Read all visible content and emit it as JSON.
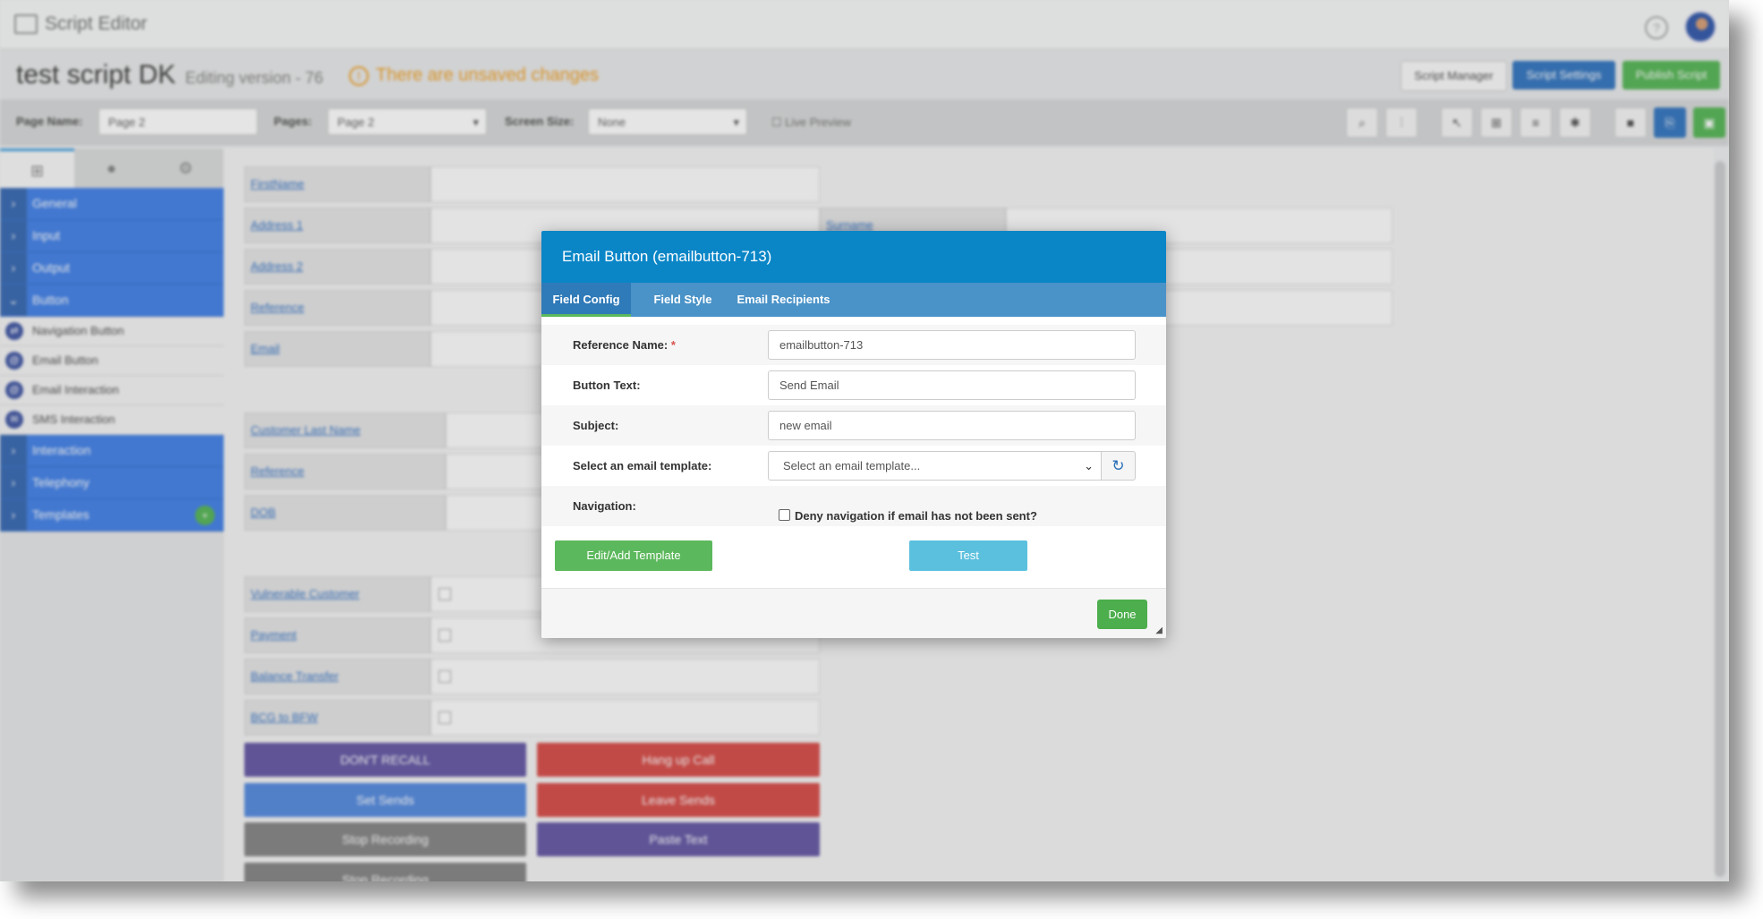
{
  "app": {
    "title": "Script Editor"
  },
  "header": {
    "script_name": "test script DK",
    "version": "Editing version - 76",
    "unsaved": "There are unsaved changes",
    "buttons": {
      "manager": "Script Manager",
      "settings": "Script Settings",
      "publish": "Publish Script"
    }
  },
  "pagebar": {
    "page_name_label": "Page Name:",
    "page_name_value": "Page 2",
    "pages_label": "Pages:",
    "pages_value": "Page 2",
    "screen_size_label": "Screen Size:",
    "screen_size_value": "None",
    "live_preview": "Live Preview",
    "tools": [
      "search-icon",
      "chart-icon",
      "pointer-icon",
      "sitemap-icon",
      "list-icon",
      "gear-icon",
      "save-icon",
      "copy-icon",
      "publish-icon"
    ]
  },
  "sidebar": {
    "categories_top": [
      {
        "label": "General"
      },
      {
        "label": "Input"
      },
      {
        "label": "Output"
      },
      {
        "label": "Button"
      }
    ],
    "button_items": [
      {
        "label": "Navigation Button"
      },
      {
        "label": "Email Button"
      },
      {
        "label": "Email Interaction"
      },
      {
        "label": "SMS Interaction"
      }
    ],
    "categories_bottom": [
      {
        "label": "Interaction"
      },
      {
        "label": "Telephony"
      },
      {
        "label": "Templates"
      }
    ]
  },
  "canvas": {
    "fields": [
      "FirstName",
      "Address 1",
      "Address 2",
      "Reference",
      "Email",
      "Customer Last Name",
      "Reference",
      "DOB",
      "Vulnerable Customer",
      "Payment",
      "Balance Transfer",
      "BCG to BFW"
    ],
    "right_field": "Surname",
    "buttons": [
      "DON'T RECALL",
      "Hang up Call",
      "Set Sends",
      "Leave Sends",
      "Stop Recording",
      "Paste Text",
      "Stop Recording"
    ],
    "colors": {
      "purple": "#6b5ea8",
      "red": "#d9534f",
      "blue": "#5b8fe0",
      "gray": "#8a8a8a"
    }
  },
  "modal": {
    "title": "Email Button (emailbutton-713)",
    "tabs": [
      "Field Config",
      "Field Style",
      "Email Recipients"
    ],
    "reference_name_label": "Reference Name:",
    "required_mark": "*",
    "reference_name_value": "emailbutton-713",
    "button_text_label": "Button Text:",
    "button_text_value": "Send Email",
    "subject_label": "Subject:",
    "subject_value": "new email",
    "template_label": "Select an email template:",
    "template_placeholder": "Select an email template...",
    "navigation_label": "Navigation:",
    "navigation_checkbox": "Deny navigation if email has not been sent?",
    "edit_template_button": "Edit/Add Template",
    "test_button": "Test",
    "done_button": "Done",
    "colors": {
      "header": "#0a86c7",
      "tabs": "#4a93c8",
      "green": "#5cb85c",
      "test": "#5bc0de"
    }
  }
}
